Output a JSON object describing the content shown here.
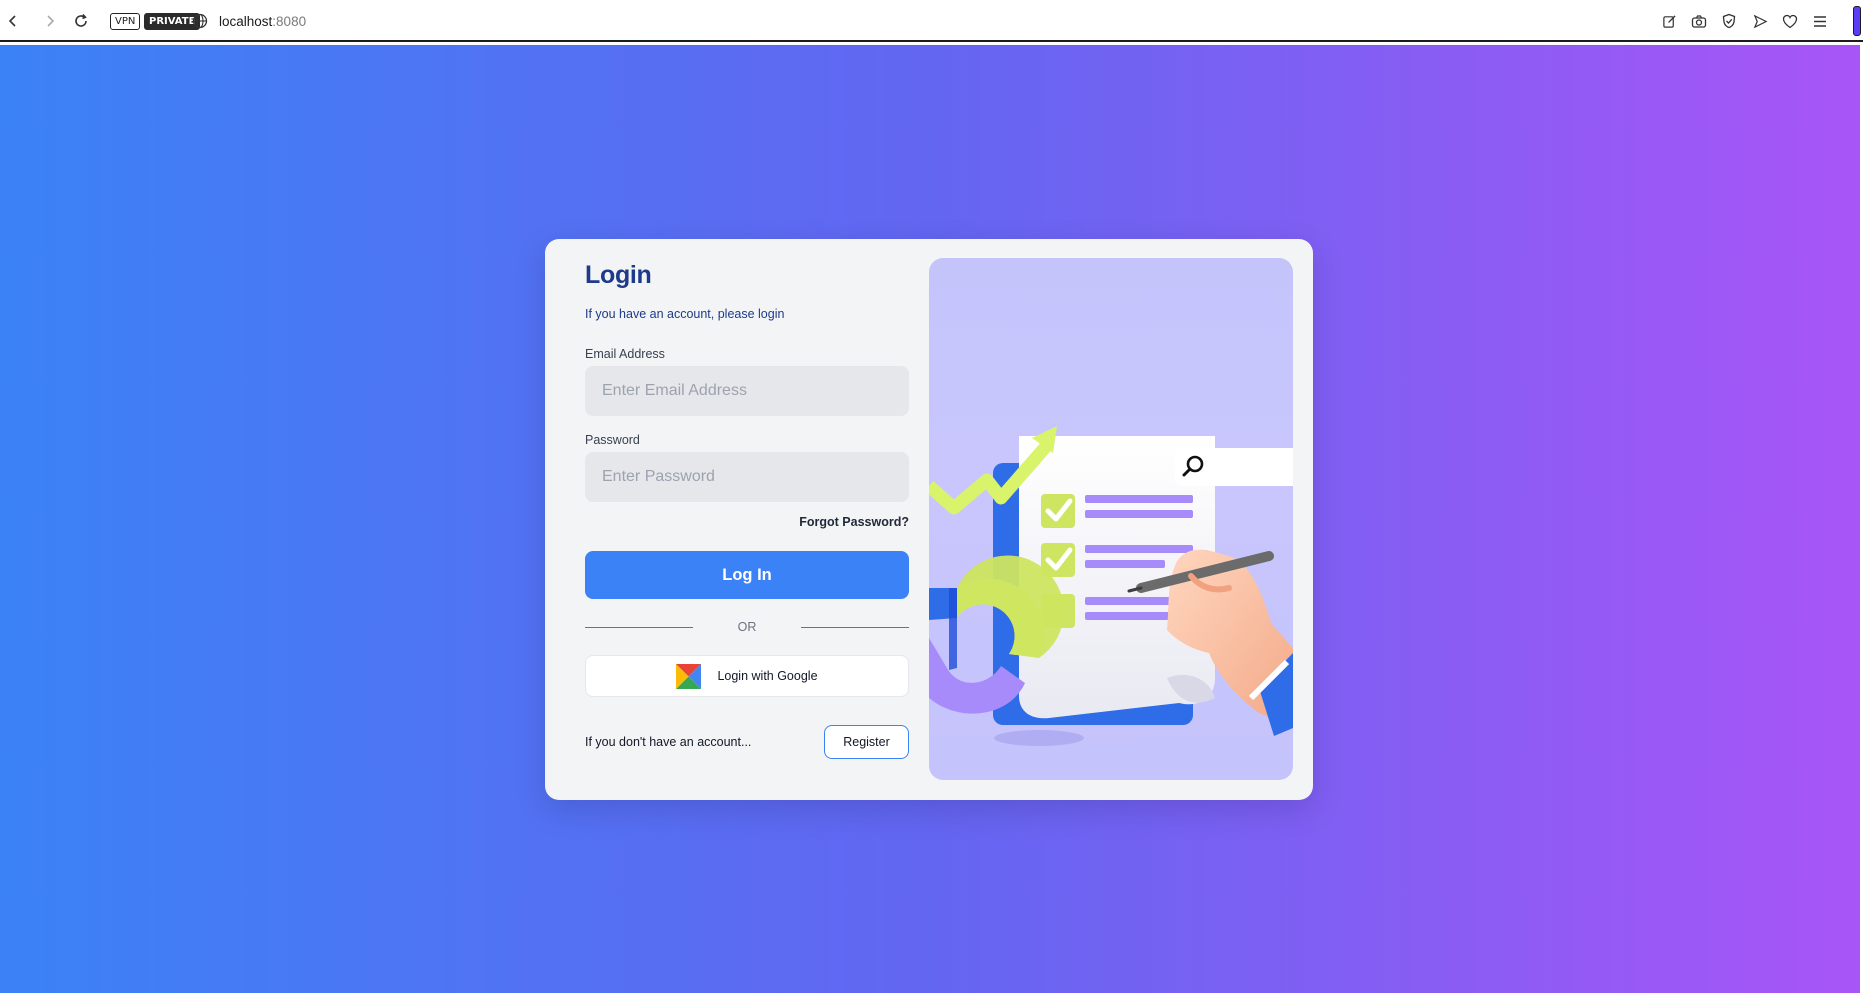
{
  "browser": {
    "badges": {
      "vpn": "VPN",
      "private": "PRIVATE"
    },
    "url": {
      "host": "localhost",
      "port": ":8080"
    },
    "icons": [
      "back-icon",
      "forward-icon",
      "reload-icon",
      "globe-icon",
      "edit-icon",
      "camera-icon",
      "shield-icon",
      "send-icon",
      "heart-icon",
      "menu-icon"
    ]
  },
  "colors": {
    "gradient_start": "#3b82f6",
    "gradient_mid": "#6366f1",
    "gradient_end": "#a855f7",
    "card_bg": "#f3f4f6",
    "title": "#1e3a8a",
    "primary_button": "#3b82f6",
    "illustration_bg": "#c7c5fc"
  },
  "login": {
    "title": "Login",
    "subtitle": "If you have an account, please login",
    "email": {
      "label": "Email Address",
      "placeholder": "Enter Email Address",
      "value": ""
    },
    "password": {
      "label": "Password",
      "placeholder": "Enter Password",
      "value": ""
    },
    "forgot_password": "Forgot Password?",
    "login_button": "Log In",
    "or_text": "OR",
    "google_button": "Login with Google",
    "register_prompt": "If you don't have an account...",
    "register_button": "Register"
  },
  "illustration": {
    "icons": [
      "trend-arrow-icon",
      "clipboard-checklist-icon",
      "checkbox-checked-icon",
      "checkbox-empty-icon",
      "search-icon",
      "donut-chart-icon",
      "hand-pen-icon"
    ]
  }
}
